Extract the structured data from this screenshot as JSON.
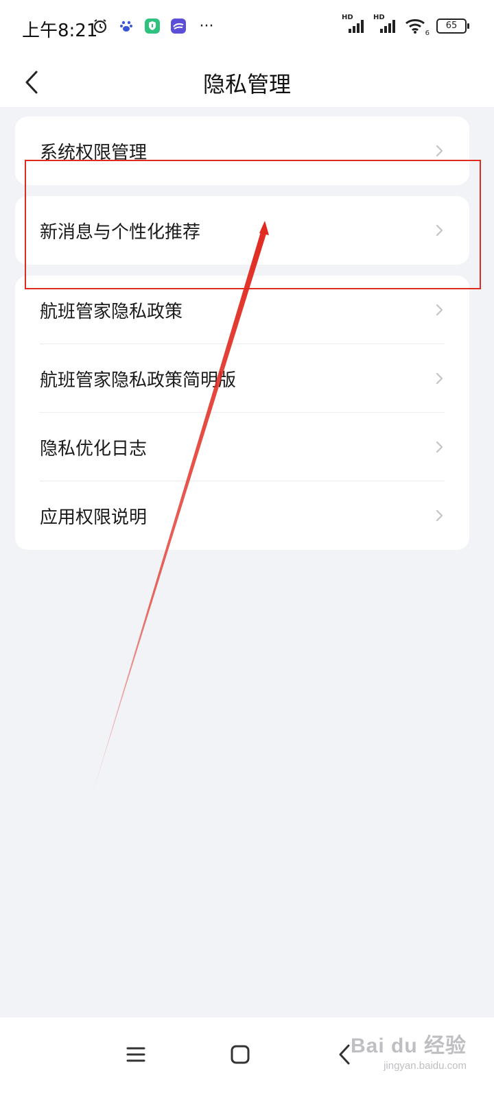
{
  "status_bar": {
    "time": "上午8:21",
    "left_icons": [
      "alarm-icon",
      "baidu-paw-icon",
      "shield-app-icon",
      "app-icon",
      "more-dots-icon"
    ],
    "signal_label_1": "HD",
    "signal_label_2": "HD",
    "wifi_label": "6",
    "battery": "65",
    "more": "···"
  },
  "header": {
    "title": "隐私管理"
  },
  "menu": {
    "card1": [
      {
        "label": "系统权限管理"
      }
    ],
    "card2": [
      {
        "label": "新消息与个性化推荐"
      }
    ],
    "card3": [
      {
        "label": "航班管家隐私政策"
      },
      {
        "label": "航班管家隐私政策简明版"
      },
      {
        "label": "隐私优化日志"
      },
      {
        "label": "应用权限说明"
      }
    ]
  },
  "colors": {
    "background": "#f2f3f7",
    "card": "#ffffff",
    "annotation": "#e02a20",
    "chevron": "#c4c4c8"
  },
  "watermark": {
    "main": "Bai du 经验",
    "sub": "jingyan.baidu.com"
  }
}
